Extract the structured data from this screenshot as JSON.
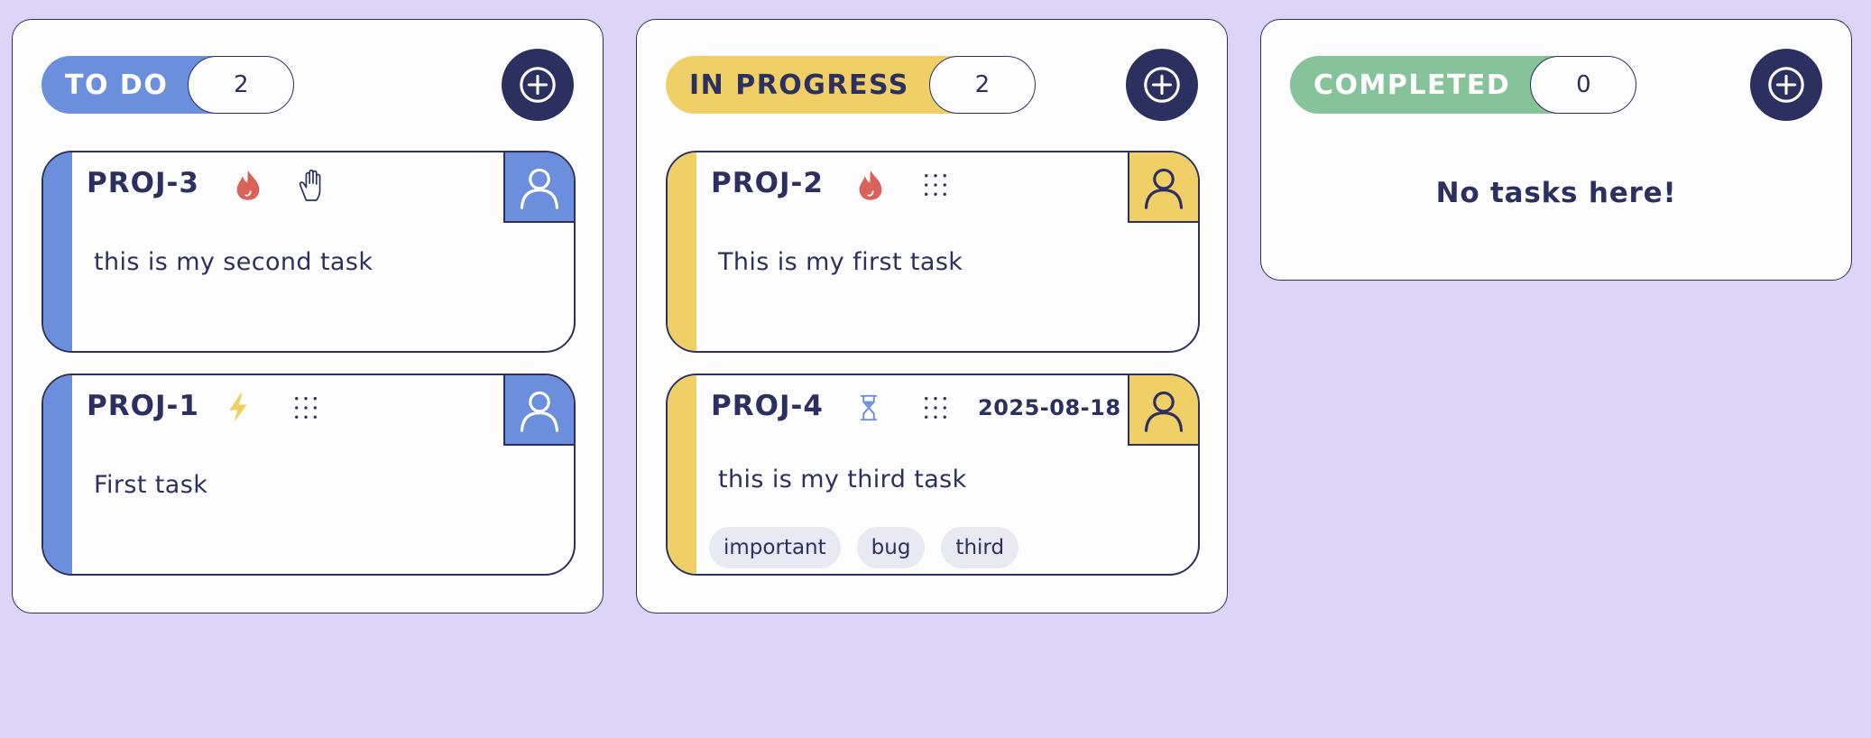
{
  "colors": {
    "background": "#ddd4f8",
    "navy": "#2c3060",
    "todo": "#6b8fdc",
    "in_progress": "#f0d066",
    "completed": "#86c29a",
    "urgent": "#d9625a",
    "lightning": "#f0d066",
    "hourglass": "#6b8fdc"
  },
  "columns": [
    {
      "title": "TO DO",
      "count": "2",
      "add_icon": "plus-circle-icon",
      "cards": [
        {
          "id": "PROJ-3",
          "priority_icon": "fire-icon",
          "drag_icon": "grab-hand-icon",
          "description": "this is my second task",
          "assignee_icon": "user-icon"
        },
        {
          "id": "PROJ-1",
          "priority_icon": "lightning-icon",
          "drag_icon": "drag-dots-icon",
          "description": "First task",
          "assignee_icon": "user-icon"
        }
      ]
    },
    {
      "title": "IN PROGRESS",
      "count": "2",
      "add_icon": "plus-circle-icon",
      "cards": [
        {
          "id": "PROJ-2",
          "priority_icon": "fire-icon",
          "drag_icon": "drag-dots-icon",
          "description": "This is my first task",
          "assignee_icon": "user-icon"
        },
        {
          "id": "PROJ-4",
          "priority_icon": "hourglass-icon",
          "drag_icon": "drag-dots-icon",
          "due_date": "2025-08-18",
          "description": "this is my third task",
          "assignee_icon": "user-icon",
          "tags": [
            "important",
            "bug",
            "third"
          ]
        }
      ]
    },
    {
      "title": "COMPLETED",
      "count": "0",
      "add_icon": "plus-circle-icon",
      "empty_message": "No tasks here!",
      "cards": []
    }
  ]
}
